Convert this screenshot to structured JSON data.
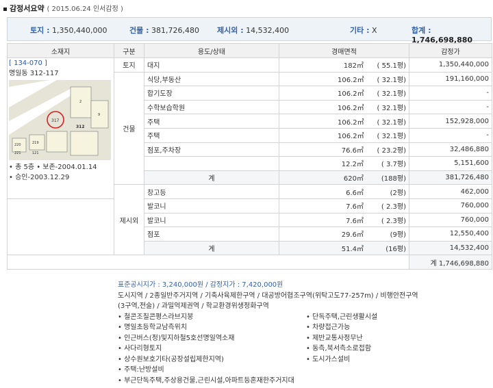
{
  "header": {
    "title": "감정서요약",
    "subtitle": "( 2015.06.24  인서감정 )"
  },
  "summary": {
    "land_label": "토지 :",
    "land_value": "1,350,440,000",
    "building_label": "건물 :",
    "building_value": "381,726,480",
    "excluded_label": "제시외 :",
    "excluded_value": "14,532,400",
    "other_label": "기타 :",
    "other_value": "X",
    "total_label": "합계 :",
    "total_value": "1,746,698,880"
  },
  "table": {
    "headers": [
      "소재지",
      "구분",
      "용도/상태",
      "경매면적",
      "감정가"
    ],
    "location": {
      "code": "[ 134-070 ]",
      "address": "명일동 312-117",
      "notes": [
        "• 총 5층  • 보존-2004.01.14",
        "• 승인-2003.12.29"
      ]
    },
    "land": {
      "group": "토지",
      "use": "대지",
      "area": "182㎡",
      "pyeong": "( 55.1평)",
      "price": "1,350,440,000"
    },
    "building": {
      "group": "건물",
      "rows": [
        {
          "use": "식당,부동산",
          "area": "106.2㎡",
          "pyeong": "( 32.1평)",
          "price": "191,160,000"
        },
        {
          "use": "합기도장",
          "area": "106.2㎡",
          "pyeong": "( 32.1평)",
          "price": "-"
        },
        {
          "use": "수학보습학원",
          "area": "106.2㎡",
          "pyeong": "( 32.1평)",
          "price": "-"
        },
        {
          "use": "주택",
          "area": "106.2㎡",
          "pyeong": "( 32.1평)",
          "price": "152,928,000"
        },
        {
          "use": "주택",
          "area": "106.2㎡",
          "pyeong": "( 32.1평)",
          "price": "-"
        },
        {
          "use": "점포,주차장",
          "area": "76.6㎡",
          "pyeong": "( 23.2평)",
          "price": "32,486,880"
        },
        {
          "use": "",
          "area": "12.2㎡",
          "pyeong": "( 3.7평)",
          "price": "5,151,600"
        }
      ],
      "sum": {
        "label": "계",
        "area": "620㎡",
        "pyeong": "(188평)",
        "price": "381,726,480"
      }
    },
    "excluded": {
      "group": "제시외",
      "rows": [
        {
          "use": "창고등",
          "area": "6.6㎡",
          "pyeong": "(2평)",
          "price": "462,000"
        },
        {
          "use": "발코니",
          "area": "7.6㎡",
          "pyeong": "( 2.3평)",
          "price": "760,000"
        },
        {
          "use": "발코니",
          "area": "7.6㎡",
          "pyeong": "( 2.3평)",
          "price": "760,000"
        },
        {
          "use": "점포",
          "area": "29.6㎡",
          "pyeong": "(9평)",
          "price": "12,550,400"
        }
      ],
      "sum": {
        "label": "계",
        "area": "51.4㎡",
        "pyeong": "(16평)",
        "price": "14,532,400"
      }
    },
    "grand_total": "계 1,746,698,880"
  },
  "map": {
    "labels": [
      "317",
      "312",
      "220",
      "219",
      "221",
      "121",
      "2",
      "9"
    ]
  },
  "notes": {
    "price_line": "표준공시지가 : 3,240,000원 / 감정지가 : 7,420,000원",
    "zoning": "도시지역 / 2종일반주거지역 / 기축사육제한구역 / 대공방어협조구역(위탁고도77-257m) / 비행안전구역",
    "zoning2": "(3구역,전술) / 과밀억제권역 / 학교환경위생정화구역",
    "items": [
      "철콘조칠콘평스라브지붕",
      "단독주택,근린생활시설",
      "명일초등학교남측위치",
      "차량접근가능",
      "인근버스(정)및지하철5호선명일역소재",
      "제반교통사정무난",
      "사다리형토지",
      "동측,북서측소로접함",
      "상수원보호기타(공장설립제한지역)",
      "도시가스설비",
      "주택:난방설비",
      "",
      "부근단독주택,주상용건물,근린시설,아파트등혼재한주거지대",
      ""
    ]
  }
}
